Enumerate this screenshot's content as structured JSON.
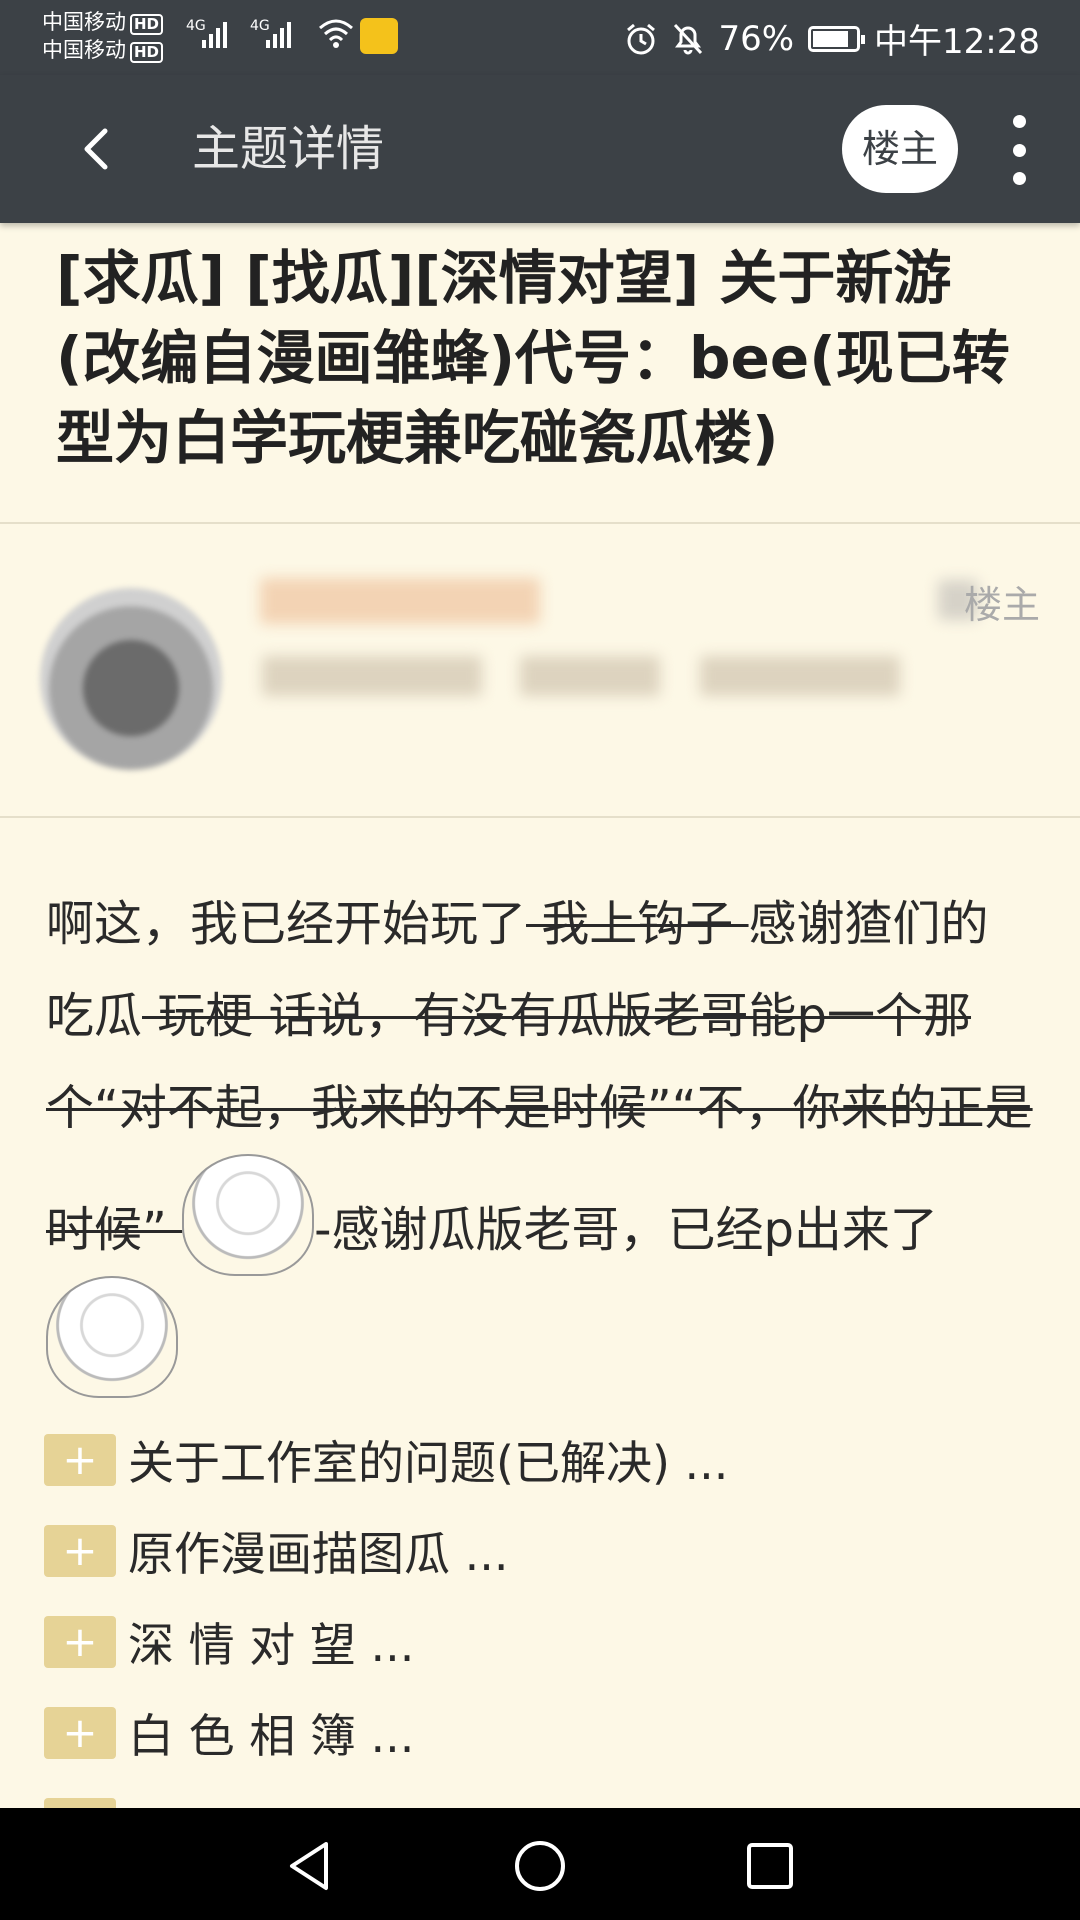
{
  "status_bar": {
    "carrier_1": "中国移动",
    "carrier_2": "中国移动",
    "hd_badge": "HD",
    "net_type": "4G",
    "battery_percent": "76%",
    "battery_level": 0.76,
    "time": "中午12:28"
  },
  "toolbar": {
    "title": "主题详情",
    "op_only_label": "楼主"
  },
  "post": {
    "title": "[求瓜] [找瓜][深情对望] 关于新游(改编自漫画雏蜂)代号：bee(现已转型为白学玩梗兼吃碰瓷瓜楼)",
    "author_tag": "楼主",
    "content": {
      "p1": "啊这，我已经开始玩了",
      "s1": " 我上钩子 ",
      "p2": "感谢猹们的吃瓜",
      "s2": " 玩梗 话说，有没有瓜版老哥能p一个那个“对不起，我来的不是时候”“不，你来的正是时候” ",
      "p3": "-感谢瓜版老哥，已经p出来了"
    },
    "folds": [
      {
        "label": "关于工作室的问题(已解决) ..."
      },
      {
        "label": "原作漫画描图瓜 ..."
      },
      {
        "label": "深 情 对 望 ..."
      },
      {
        "label": "白 色 相 簿 ..."
      }
    ]
  },
  "colors": {
    "toolbar_bg": "#3c4146",
    "page_bg": "#fdf8e6",
    "fold_plus": "#e6d396"
  }
}
